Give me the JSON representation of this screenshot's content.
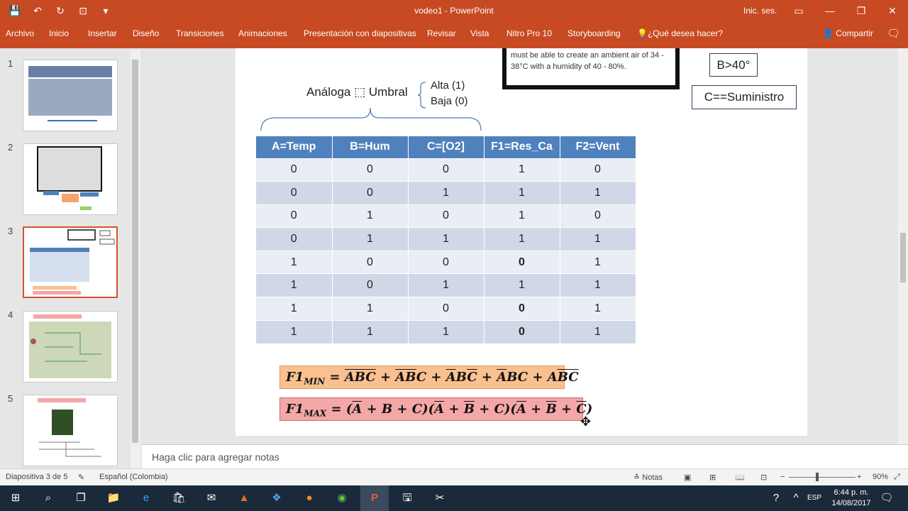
{
  "window": {
    "title": "vodeo1 - PowerPoint",
    "signin": "Inic. ses.",
    "qat": [
      {
        "name": "save-icon",
        "glyph": "💾"
      },
      {
        "name": "undo-icon",
        "glyph": "↶"
      },
      {
        "name": "redo-icon",
        "glyph": "↻"
      },
      {
        "name": "present-icon",
        "glyph": "⊡"
      },
      {
        "name": "customize-icon",
        "glyph": "▾"
      }
    ],
    "controls": [
      {
        "name": "ribbon-display-icon",
        "glyph": "▭"
      },
      {
        "name": "minimize-icon",
        "glyph": "—"
      },
      {
        "name": "restore-icon",
        "glyph": "❐"
      },
      {
        "name": "close-icon",
        "glyph": "✕"
      }
    ]
  },
  "ribbon": {
    "tabs": [
      "Archivo",
      "Inicio",
      "Insertar",
      "Diseño",
      "Transiciones",
      "Animaciones",
      "Presentación con diapositivas",
      "Revisar",
      "Vista",
      "Nitro Pro 10",
      "Storyboarding"
    ],
    "tell_me": "¿Qué desea hacer?",
    "share": "Compartir"
  },
  "thumbnails": [
    "1",
    "2",
    "3",
    "4",
    "5"
  ],
  "slide": {
    "info_text": "must be able to create an ambient air of 34 - 38°C with a humidity of 40 - 80%.",
    "box_b": "B>40°",
    "box_c": "C==Suministro",
    "analog": "Análoga ⬚ Umbral",
    "alta": "Alta (1)",
    "baja": "Baja (0)",
    "table": {
      "headers": [
        "A=Temp",
        "B=Hum",
        "C=[O2]",
        "F1=Res_Ca",
        "F2=Vent"
      ],
      "rows": [
        [
          "0",
          "0",
          "0",
          "1",
          "0"
        ],
        [
          "0",
          "0",
          "1",
          "1",
          "1"
        ],
        [
          "0",
          "1",
          "0",
          "1",
          "0"
        ],
        [
          "0",
          "1",
          "1",
          "1",
          "1"
        ],
        [
          "1",
          "0",
          "0",
          "0",
          "1"
        ],
        [
          "1",
          "0",
          "1",
          "1",
          "1"
        ],
        [
          "1",
          "1",
          "0",
          "0",
          "1"
        ],
        [
          "1",
          "1",
          "1",
          "0",
          "1"
        ]
      ]
    },
    "eq1_label": "F1",
    "eq1_sub": "MIN",
    "eq2_label": "F1",
    "eq2_sub": "MAX"
  },
  "notes_placeholder": "Haga clic para agregar notas",
  "status": {
    "slide": "Diapositiva 3 de 5",
    "language": "Español (Colombia)",
    "notes": "Notas",
    "zoom": "90%"
  },
  "taskbar": {
    "lang": "ESP",
    "time": "6:44 p. m.",
    "date": "14/08/2017"
  },
  "colors": {
    "accent": "#c74a22",
    "table_header": "#4f81bd",
    "eq_min_bg": "#fac090",
    "eq_max_bg": "#f4a7a7"
  }
}
